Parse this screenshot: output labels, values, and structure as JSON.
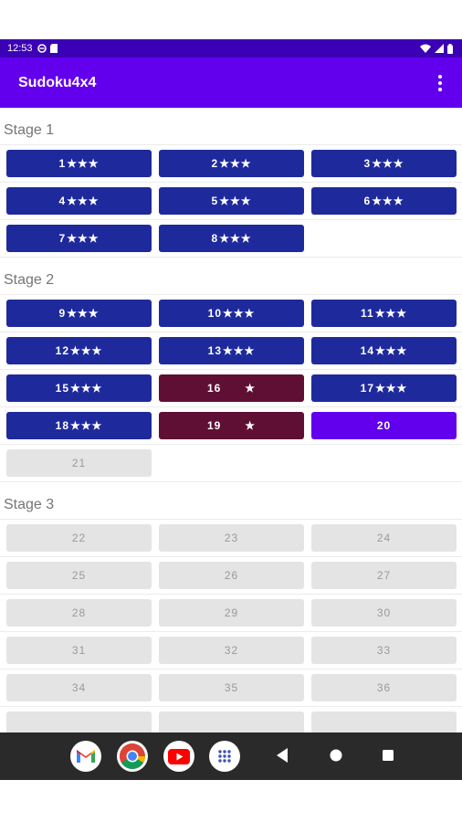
{
  "status_bar": {
    "time": "12:53",
    "colors": {
      "bg": "#3b00b5"
    }
  },
  "app_bar": {
    "title": "Sudoku4x4",
    "colors": {
      "bg": "#6200ee"
    }
  },
  "colors": {
    "clear": "#1e2a9c",
    "partial": "#5f0f34",
    "current": "#6200ee",
    "locked": "#e4e4e4",
    "locked_text": "#9a9a9a"
  },
  "stages": [
    {
      "title": "Stage 1",
      "levels": [
        {
          "num": "1",
          "stars": "★★★",
          "state": "clear"
        },
        {
          "num": "2",
          "stars": "★★★",
          "state": "clear"
        },
        {
          "num": "3",
          "stars": "★★★",
          "state": "clear"
        },
        {
          "num": "4",
          "stars": "★★★",
          "state": "clear"
        },
        {
          "num": "5",
          "stars": "★★★",
          "state": "clear"
        },
        {
          "num": "6",
          "stars": "★★★",
          "state": "clear"
        },
        {
          "num": "7",
          "stars": "★★★",
          "state": "clear"
        },
        {
          "num": "8",
          "stars": "★★★",
          "state": "clear"
        }
      ]
    },
    {
      "title": "Stage 2",
      "levels": [
        {
          "num": "9",
          "stars": "★★★",
          "state": "clear"
        },
        {
          "num": "10",
          "stars": "★★★",
          "state": "clear"
        },
        {
          "num": "11",
          "stars": "★★★",
          "state": "clear"
        },
        {
          "num": "12",
          "stars": "★★★",
          "state": "clear"
        },
        {
          "num": "13",
          "stars": "★★★",
          "state": "clear"
        },
        {
          "num": "14",
          "stars": "★★★",
          "state": "clear"
        },
        {
          "num": "15",
          "stars": "★★★",
          "state": "clear"
        },
        {
          "num": "16",
          "stars": "★",
          "state": "partial"
        },
        {
          "num": "17",
          "stars": "★★★",
          "state": "clear"
        },
        {
          "num": "18",
          "stars": "★★★",
          "state": "clear"
        },
        {
          "num": "19",
          "stars": "★",
          "state": "partial"
        },
        {
          "num": "20",
          "stars": "",
          "state": "current"
        },
        {
          "num": "21",
          "stars": "",
          "state": "locked"
        }
      ]
    },
    {
      "title": "Stage 3",
      "levels": [
        {
          "num": "22",
          "stars": "",
          "state": "locked"
        },
        {
          "num": "23",
          "stars": "",
          "state": "locked"
        },
        {
          "num": "24",
          "stars": "",
          "state": "locked"
        },
        {
          "num": "25",
          "stars": "",
          "state": "locked"
        },
        {
          "num": "26",
          "stars": "",
          "state": "locked"
        },
        {
          "num": "27",
          "stars": "",
          "state": "locked"
        },
        {
          "num": "28",
          "stars": "",
          "state": "locked"
        },
        {
          "num": "29",
          "stars": "",
          "state": "locked"
        },
        {
          "num": "30",
          "stars": "",
          "state": "locked"
        },
        {
          "num": "31",
          "stars": "",
          "state": "locked"
        },
        {
          "num": "32",
          "stars": "",
          "state": "locked"
        },
        {
          "num": "33",
          "stars": "",
          "state": "locked"
        },
        {
          "num": "34",
          "stars": "",
          "state": "locked"
        },
        {
          "num": "35",
          "stars": "",
          "state": "locked"
        },
        {
          "num": "36",
          "stars": "",
          "state": "locked"
        },
        {
          "num": "",
          "stars": "",
          "state": "locked"
        },
        {
          "num": "",
          "stars": "",
          "state": "locked"
        },
        {
          "num": "",
          "stars": "",
          "state": "locked"
        }
      ]
    }
  ],
  "nav_bar": {
    "apps": [
      {
        "icon": "gmail-icon"
      },
      {
        "icon": "chrome-icon"
      },
      {
        "icon": "youtube-icon"
      },
      {
        "icon": "app-drawer-icon"
      }
    ],
    "buttons": [
      {
        "icon": "back-icon"
      },
      {
        "icon": "home-icon"
      },
      {
        "icon": "recents-icon"
      }
    ]
  }
}
